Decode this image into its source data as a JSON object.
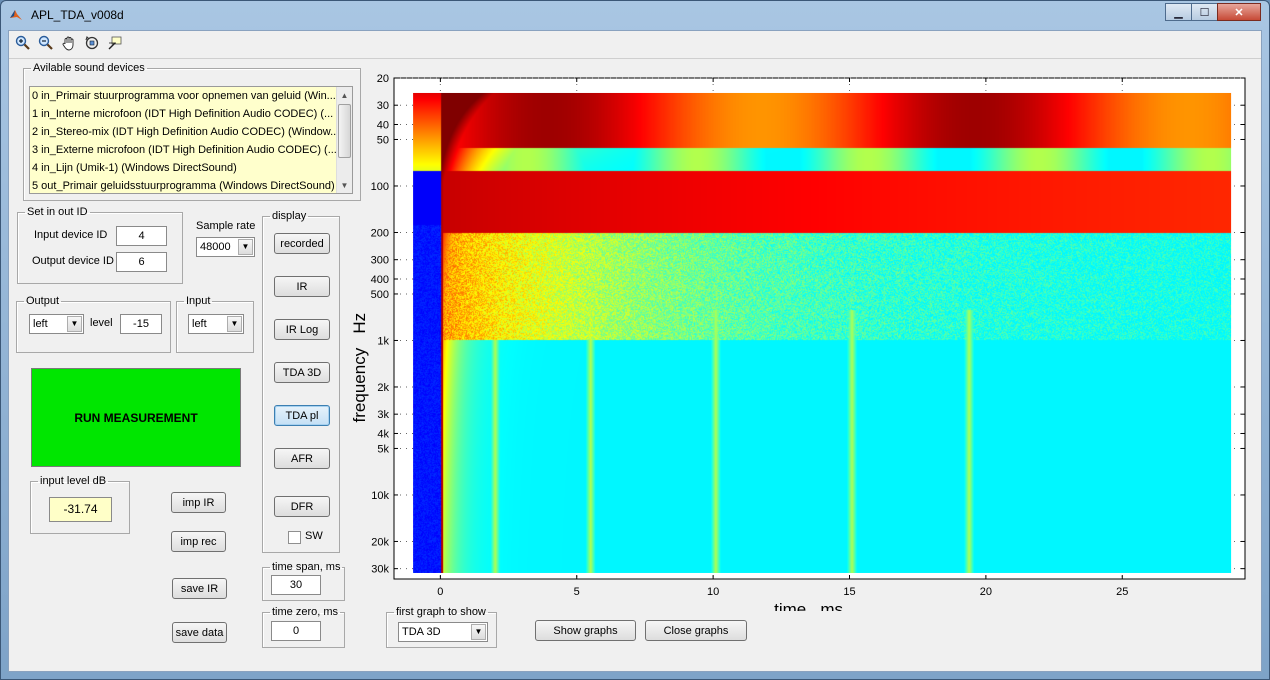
{
  "window": {
    "title": "APL_TDA_v008d"
  },
  "toolbar": {
    "icons": [
      "zoom-in-icon",
      "zoom-out-icon",
      "pan-hand-icon",
      "rotate-3d-icon",
      "data-cursor-icon"
    ]
  },
  "devices": {
    "legend": "Avilable sound devices",
    "items": [
      "0 in_Primair stuurprogramma voor opnemen van geluid (Win...",
      "1 in_Interne microfoon (IDT High Definition Audio CODEC) (...",
      "2 in_Stereo-mix (IDT High Definition Audio CODEC) (Window...",
      "3 in_Externe microfoon (IDT High Definition Audio CODEC) (...",
      "4 in_Lijn (Umik-1) (Windows DirectSound)",
      "5 out_Primair geluidsstuurprogramma (Windows DirectSound)"
    ]
  },
  "io": {
    "legend": "Set in out ID",
    "input_label": "Input device ID",
    "input_value": "4",
    "output_label": "Output device ID",
    "output_value": "6"
  },
  "sample_rate": {
    "label": "Sample rate",
    "value": "48000"
  },
  "output": {
    "legend": "Output",
    "channel": "left",
    "level_label": "level",
    "level_value": "-15"
  },
  "input": {
    "legend": "Input",
    "channel": "left"
  },
  "run": {
    "label": "RUN MEASUREMENT"
  },
  "input_level": {
    "legend": "input level dB",
    "value": "-31.74"
  },
  "buttons": {
    "imp_ir": "imp IR",
    "imp_rec": "imp rec",
    "save_ir": "save IR",
    "save_data": "save data"
  },
  "display": {
    "legend": "display",
    "buttons": [
      "recorded",
      "IR",
      "IR Log",
      "TDA 3D",
      "TDA pl",
      "AFR",
      "DFR"
    ],
    "sw_label": "SW"
  },
  "time_span": {
    "legend": "time span, ms",
    "value": "30"
  },
  "time_zero": {
    "legend": "time zero, ms",
    "value": "0"
  },
  "first_graph": {
    "legend": "first graph to show",
    "value": "TDA 3D"
  },
  "actions": {
    "show": "Show graphs",
    "close": "Close graphs"
  },
  "chart_data": {
    "type": "heatmap",
    "xlabel": "time   ms",
    "ylabel": "frequency   Hz",
    "y_scale": "log",
    "xlim": [
      -1.7,
      29.5
    ],
    "ylim": [
      20,
      35000
    ],
    "data_x_range": [
      -1,
      29
    ],
    "data_y_range": [
      25,
      32000
    ],
    "x_ticks": [
      0,
      5,
      10,
      15,
      20,
      25
    ],
    "y_ticks": [
      {
        "v": 20,
        "t": "20"
      },
      {
        "v": 30,
        "t": "30"
      },
      {
        "v": 40,
        "t": "40"
      },
      {
        "v": 50,
        "t": "50"
      },
      {
        "v": 100,
        "t": "100"
      },
      {
        "v": 200,
        "t": "200"
      },
      {
        "v": 300,
        "t": "300"
      },
      {
        "v": 400,
        "t": "400"
      },
      {
        "v": 500,
        "t": "500"
      },
      {
        "v": 1000,
        "t": "1k"
      },
      {
        "v": 2000,
        "t": "2k"
      },
      {
        "v": 3000,
        "t": "3k"
      },
      {
        "v": 4000,
        "t": "4k"
      },
      {
        "v": 5000,
        "t": "5k"
      },
      {
        "v": 10000,
        "t": "10k"
      },
      {
        "v": 20000,
        "t": "20k"
      },
      {
        "v": 30000,
        "t": "30k"
      }
    ],
    "colormap": "jet",
    "grid": "dotted"
  }
}
